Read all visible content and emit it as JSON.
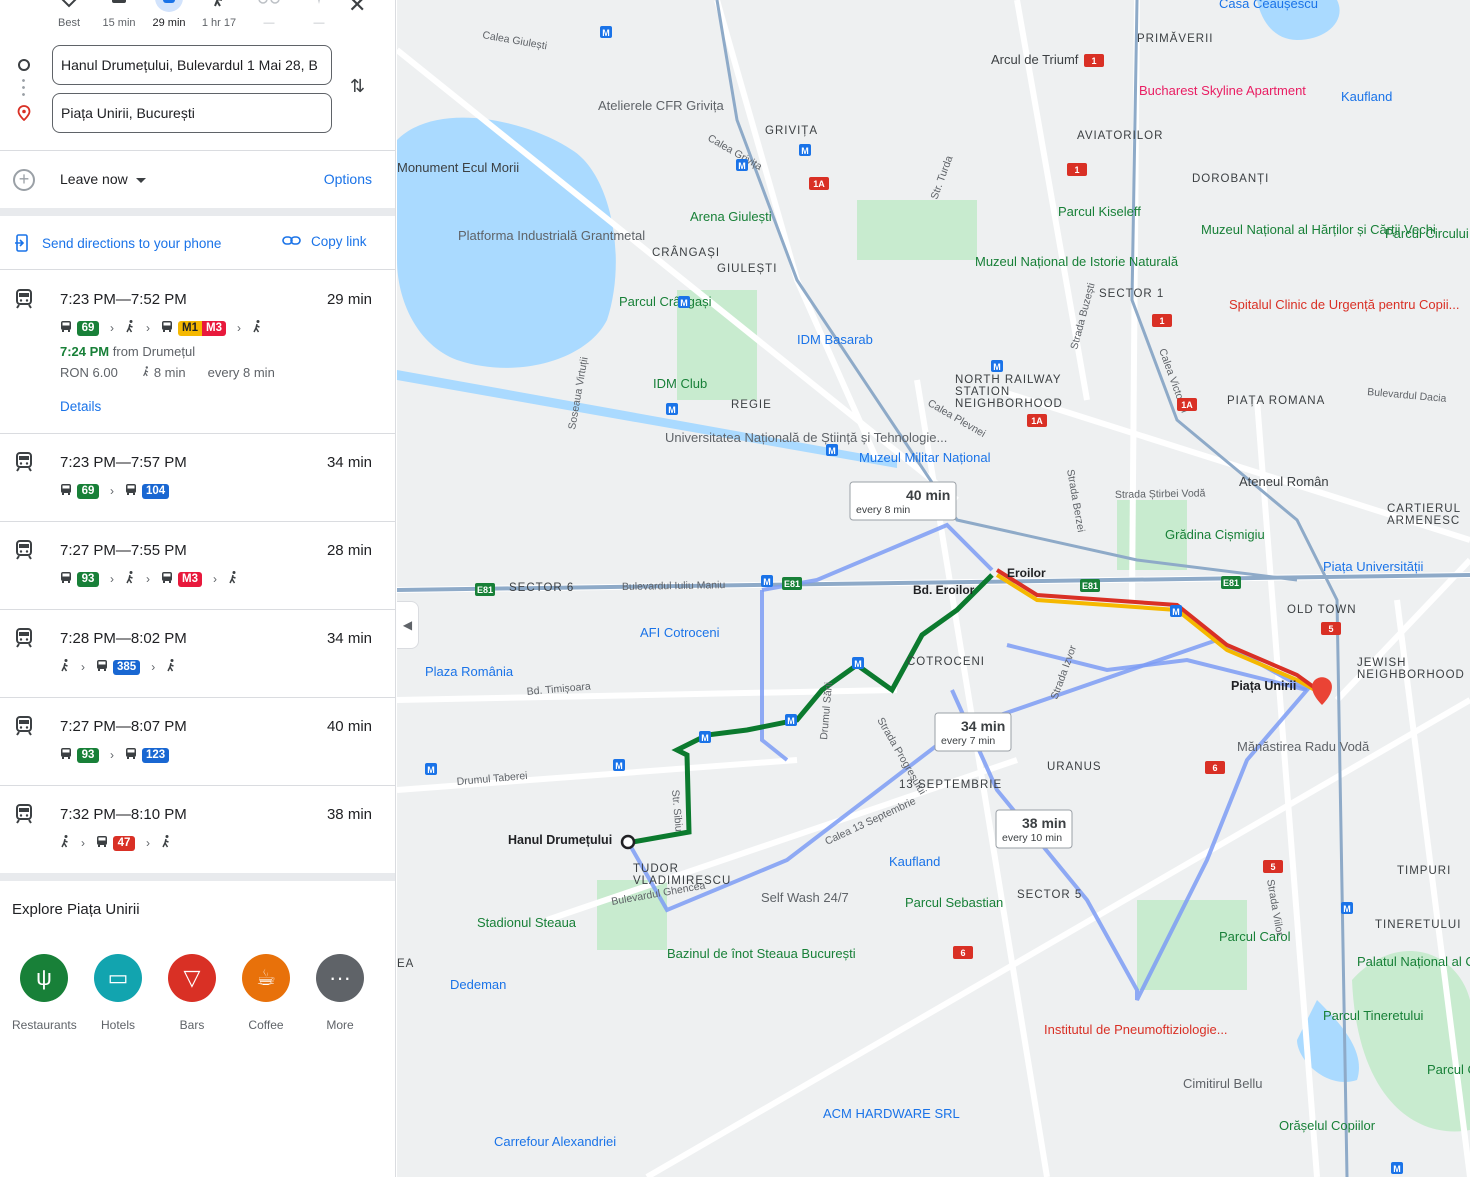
{
  "modes": [
    {
      "label": "Best",
      "icon": "best-diamond-icon"
    },
    {
      "label": "15 min",
      "icon": "car-icon"
    },
    {
      "label": "29 min",
      "icon": "transit-icon"
    },
    {
      "label": "1 hr 17",
      "icon": "walk-icon"
    },
    {
      "label": "—",
      "icon": "bike-icon"
    },
    {
      "label": "—",
      "icon": "plane-icon"
    }
  ],
  "origin": "Hanul Drumețului, Bulevardul 1 Mai 28, B",
  "destination": "Piața Unirii, București",
  "leave_now": "Leave now",
  "options": "Options",
  "send_directions": "Send directions to your phone",
  "copy_link": "Copy link",
  "colors": {
    "green": "#188038",
    "blue": "#1a73e8",
    "m1": "#f5b800",
    "m3": "#e8193c",
    "bus_blue": "#1967d2",
    "bus_red": "#d93025"
  },
  "trips": [
    {
      "time": "7:23 PM—7:52 PM",
      "duration": "29 min",
      "legs": [
        {
          "type": "bus",
          "label": "69",
          "color": "#188038"
        },
        {
          "type": "walk"
        },
        {
          "type": "metro",
          "labels": [
            "M1",
            "M3"
          ]
        },
        {
          "type": "walk"
        }
      ],
      "depart_time": "7:24 PM",
      "depart_from": " from Drumețul",
      "fare": "RON 6.00",
      "walk": "8 min",
      "every": "every 8 min",
      "details": "Details"
    },
    {
      "time": "7:23 PM—7:57 PM",
      "duration": "34 min",
      "legs": [
        {
          "type": "bus",
          "label": "69",
          "color": "#188038"
        },
        {
          "type": "bus",
          "label": "104",
          "color": "#1967d2"
        }
      ]
    },
    {
      "time": "7:27 PM—7:55 PM",
      "duration": "28 min",
      "legs": [
        {
          "type": "bus",
          "label": "93",
          "color": "#188038"
        },
        {
          "type": "walk"
        },
        {
          "type": "metro1",
          "label": "M3",
          "color": "#e8193c"
        },
        {
          "type": "walk"
        }
      ]
    },
    {
      "time": "7:28 PM—8:02 PM",
      "duration": "34 min",
      "legs": [
        {
          "type": "walk"
        },
        {
          "type": "bus",
          "label": "385",
          "color": "#1967d2"
        },
        {
          "type": "walk"
        }
      ]
    },
    {
      "time": "7:27 PM—8:07 PM",
      "duration": "40 min",
      "legs": [
        {
          "type": "bus",
          "label": "93",
          "color": "#188038"
        },
        {
          "type": "bus",
          "label": "123",
          "color": "#1967d2"
        }
      ]
    },
    {
      "time": "7:32 PM—8:10 PM",
      "duration": "38 min",
      "legs": [
        {
          "type": "walk"
        },
        {
          "type": "trolley",
          "label": "47",
          "color": "#d93025"
        },
        {
          "type": "walk"
        }
      ]
    }
  ],
  "explore_title": "Explore Piața Unirii",
  "categories": [
    {
      "label": "Restaurants",
      "color": "#188038",
      "icon": "fork-knife-icon"
    },
    {
      "label": "Hotels",
      "color": "#12a4af",
      "icon": "bed-icon"
    },
    {
      "label": "Bars",
      "color": "#d93025",
      "icon": "cocktail-icon"
    },
    {
      "label": "Coffee",
      "color": "#e8710a",
      "icon": "coffee-cup-icon"
    },
    {
      "label": "More",
      "color": "#5f6368",
      "icon": "more-dots-icon"
    }
  ],
  "map": {
    "district_labels": [
      "PRIMĂVERII",
      "AVIATORILOR",
      "DOROBANȚI",
      "GRIVIȚA",
      "CRÂNGAȘI",
      "GIULEȘTI",
      "REGIE",
      "NORTH RAILWAY STATION NEIGHBORHOOD",
      "PIAȚA ROMANA",
      "CARTIERUL ARMENESC",
      "OLD TOWN",
      "JEWISH NEIGHBORHOOD",
      "COTROCENI",
      "URANUS",
      "13 SEPTEMBRIE",
      "TUDOR VLADIMIRESCU",
      "SECTOR 1",
      "SECTOR 6",
      "SECTOR 5",
      "TIMPURI",
      "TINERETULUI",
      "EA"
    ],
    "places": [
      "Casa Ceaușescu",
      "Arcul de Triumf",
      "Bucharest Skyline Apartment",
      "Kaufland",
      "Atelierele CFR Grivița",
      "Monument Ecul Morii",
      "Platforma Industrială Grantmetal",
      "Arena Giulești",
      "Parcul Kiseleff",
      "Muzeul Național al Hărților și Cărții Vechi",
      "Parcul Circului",
      "Muzeul Național de Istorie Naturală",
      "Spitalul Clinic de Urgență pentru Copii...",
      "Parcul Crângași",
      "IDM Basarab",
      "IDM Club",
      "Universitatea Națională de Știință și Tehnologie...",
      "Muzeul Militar Național",
      "Ateneul Român",
      "Grădina Cișmigiu",
      "Piața Universității",
      "AFI Cotroceni",
      "Plaza România",
      "Piața Unirii",
      "Mănăstirea Radu Vodă",
      "Hanul Drumețului",
      "Kaufland",
      "Self Wash 24/7",
      "Parcul Sebastian",
      "Stadionul Steaua",
      "Bazinul de înot Steaua București",
      "Dedeman",
      "Parcul Carol",
      "Palatul Național al Copiilor din București",
      "Parcul Tineretului",
      "Institutul de Pneumoftiziologie...",
      "Cimitirul Bellu",
      "ACM HARDWARE SRL",
      "Carrefour Alexandriei",
      "Orășelul Copiilor",
      "Parcul Cop"
    ],
    "streets": [
      "Calea Giulești",
      "Calea Grivița",
      "Bulevardul Iuliu Maniu",
      "Bd. Timișoara",
      "Drumul Taberei",
      "Calea 13 Septembrie",
      "Bulevardul Ghencea",
      "Strada Progresului",
      "Strada Buzești",
      "Calea Victoriei",
      "Strada Știrbei Vodă",
      "Str. Sibiu",
      "Bulevardul Dacia",
      "Calea Plevnei",
      "Strada Berzei",
      "Soseaua Virtuții",
      "Drumul Sării",
      "Strada Izvor",
      "Strada Viilor",
      "Str. Turda"
    ],
    "stops": [
      "Eroilor",
      "Bd. Eroilor"
    ],
    "callouts": [
      {
        "title": "40 min",
        "sub": "every 8 min"
      },
      {
        "title": "34 min",
        "sub": "every 7 min"
      },
      {
        "title": "38 min",
        "sub": "every 10 min"
      }
    ],
    "road_badges": [
      "E81",
      "1",
      "1A",
      "5",
      "6"
    ],
    "collapse_icon": "chevron-left-icon"
  }
}
